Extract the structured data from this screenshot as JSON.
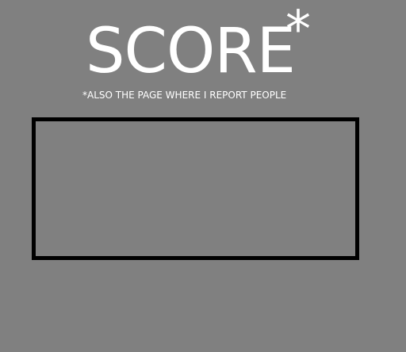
{
  "header": {
    "title": "SCORE",
    "title_mark": "*",
    "footnote": "*ALSO THE PAGE WHERE I REPORT PEOPLE"
  },
  "colors": {
    "background": "#808080",
    "text": "#ffffff",
    "box_border": "#000000"
  }
}
